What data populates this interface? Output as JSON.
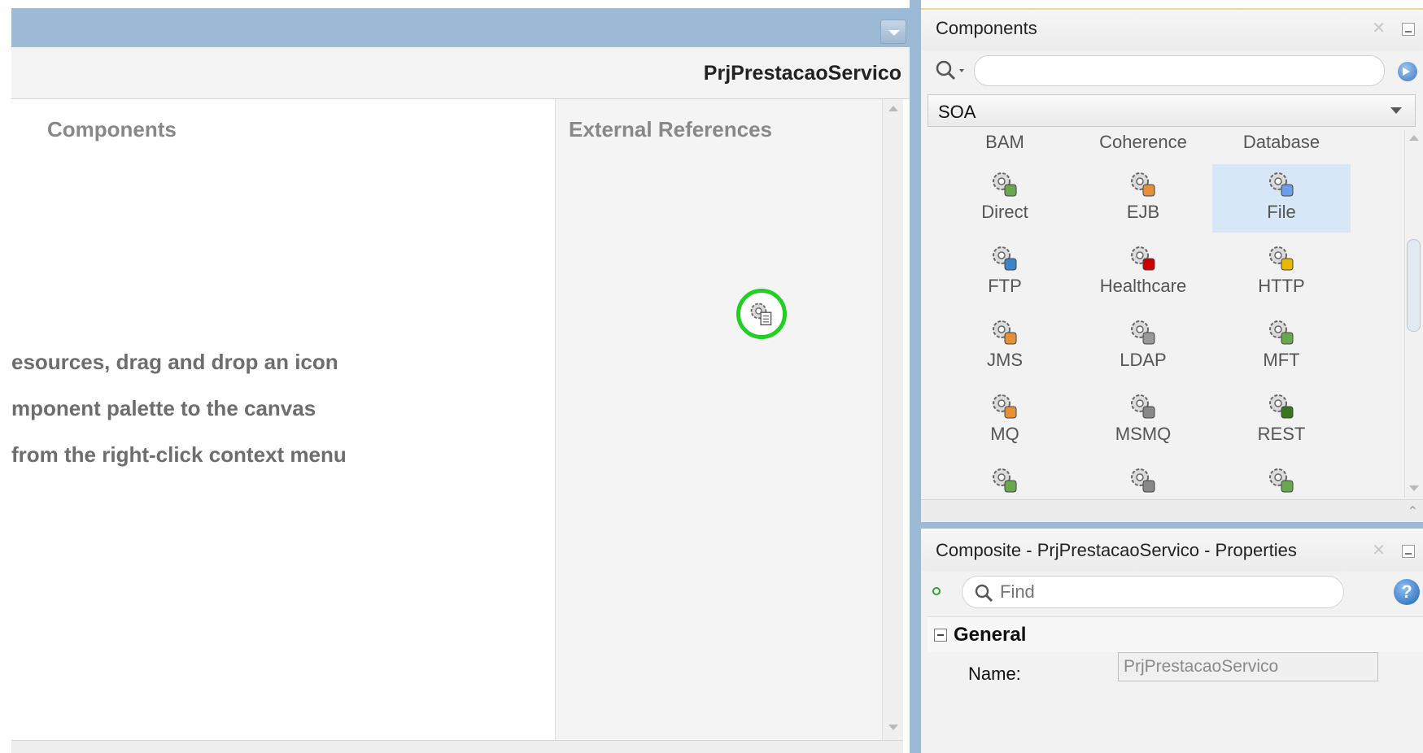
{
  "editor": {
    "title": "PrjPrestacaoServico",
    "components_label": "Components",
    "external_refs_label": "External References",
    "hint_lines": [
      "esources, drag and drop an icon",
      "mponent palette to the canvas",
      "from the right-click context menu"
    ],
    "drop_marker_icon": "file-adapter-icon"
  },
  "palette": {
    "title": "Components",
    "search_value": "",
    "category": "SOA",
    "headers": [
      "BAM",
      "Coherence",
      "Database"
    ],
    "items": [
      {
        "label": "Direct",
        "icon": "direct-adapter-icon",
        "selected": false
      },
      {
        "label": "EJB",
        "icon": "ejb-adapter-icon",
        "selected": false
      },
      {
        "label": "File",
        "icon": "file-adapter-icon",
        "selected": true
      },
      {
        "label": "FTP",
        "icon": "ftp-adapter-icon",
        "selected": false
      },
      {
        "label": "Healthcare",
        "icon": "healthcare-adapter-icon",
        "selected": false
      },
      {
        "label": "HTTP",
        "icon": "http-binding-icon",
        "selected": false
      },
      {
        "label": "JMS",
        "icon": "jms-adapter-icon",
        "selected": false
      },
      {
        "label": "LDAP",
        "icon": "ldap-adapter-icon",
        "selected": false
      },
      {
        "label": "MFT",
        "icon": "mft-adapter-icon",
        "selected": false
      },
      {
        "label": "MQ",
        "icon": "mq-adapter-icon",
        "selected": false
      },
      {
        "label": "MSMQ",
        "icon": "msmq-adapter-icon",
        "selected": false
      },
      {
        "label": "REST",
        "icon": "rest-adapter-icon",
        "selected": false
      },
      {
        "label": "",
        "icon": "adapter-icon",
        "selected": false
      },
      {
        "label": "",
        "icon": "socket-adapter-icon",
        "selected": false
      },
      {
        "label": "",
        "icon": "tuxedo-adapter-icon",
        "selected": false
      }
    ]
  },
  "properties": {
    "title": "Composite - PrjPrestacaoServico - Properties",
    "find_placeholder": "Find",
    "section": "General",
    "name_label": "Name:",
    "name_value": "PrjPrestacaoServico"
  },
  "colors": {
    "title_bar": "#9cb9d5",
    "selection": "#d8e7f8",
    "drop_marker": "#22d022"
  }
}
